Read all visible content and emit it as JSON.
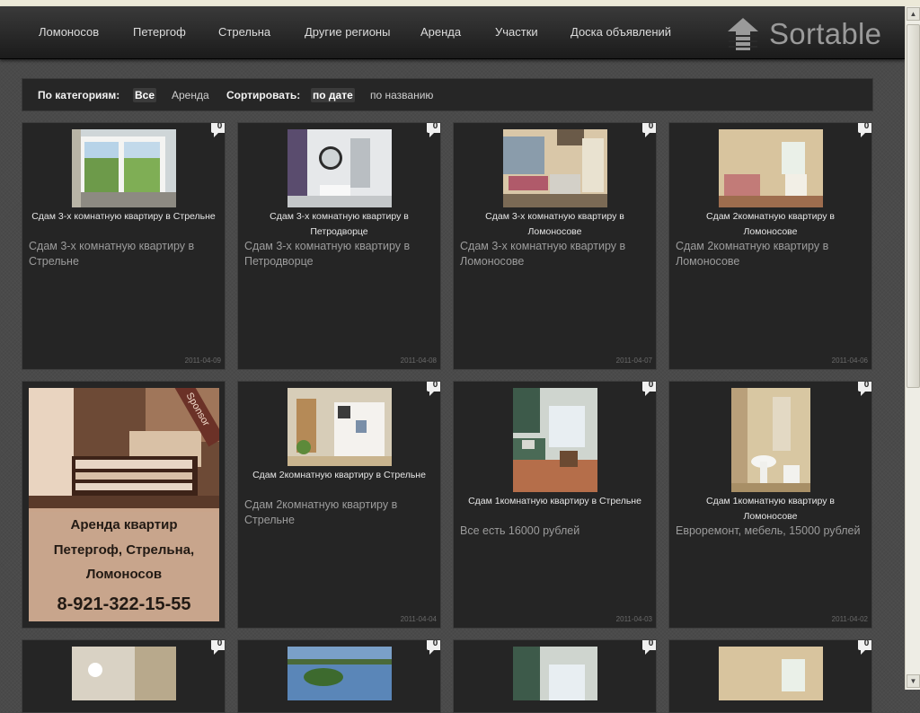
{
  "nav": {
    "items": [
      "Ломоносов",
      "Петергоф",
      "Стрельна",
      "Другие регионы",
      "Аренда",
      "Участки",
      "Доска объявлений"
    ],
    "logo_text": "Sortable",
    "logo_icon": "up-arrow-box-icon"
  },
  "filter": {
    "categories_label": "По категориям:",
    "all_label": "Все",
    "rent_label": "Аренда",
    "sort_label": "Сортировать:",
    "by_date_label": "по дате",
    "by_name_label": "по названию"
  },
  "cards": [
    {
      "caption": "Сдам 3-х комнатную квартиру в Стрельне",
      "desc": "Сдам 3-х комнатную квартиру в Стрельне",
      "date": "2011-04-09",
      "comments": "0"
    },
    {
      "caption": "Сдам 3-х комнатную квартиру в Петродворце",
      "desc": "Сдам 3-х комнатную квартиру в Петродворце",
      "date": "2011-04-08",
      "comments": "0"
    },
    {
      "caption": "Сдам 3-х комнатную квартиру в Ломоносове",
      "desc": "Сдам 3-х комнатную квартиру в Ломоносове",
      "date": "2011-04-07",
      "comments": "0"
    },
    {
      "caption": "Сдам 2комнатную квартиру в Ломоносове",
      "desc": "Сдам 2комнатную квартиру в Ломоносове",
      "date": "2011-04-06",
      "comments": "0"
    },
    {
      "caption": "Сдам 2комнатную квартиру в Стрельне",
      "desc": "Сдам 2комнатную квартиру в Стрельне",
      "date": "2011-04-04",
      "comments": "0"
    },
    {
      "caption": "Сдам 1комнатную квартиру в Стрельне",
      "desc": "Все есть 16000 рублей",
      "date": "2011-04-03",
      "comments": "0"
    },
    {
      "caption": "Сдам 1комнатную квартиру в Ломоносове",
      "desc": "Евроремонт, мебель, 15000 рублей",
      "date": "2011-04-02",
      "comments": "0"
    },
    {
      "comments": "0"
    },
    {
      "comments": "0"
    },
    {
      "comments": "0"
    },
    {
      "comments": "0"
    }
  ],
  "sponsor": {
    "ribbon": "Sponsor",
    "line1": "Аренда квартир",
    "line2": "Петергоф, Стрельна,",
    "line3": "Ломоносов",
    "phone": "8-921-322-15-55"
  }
}
